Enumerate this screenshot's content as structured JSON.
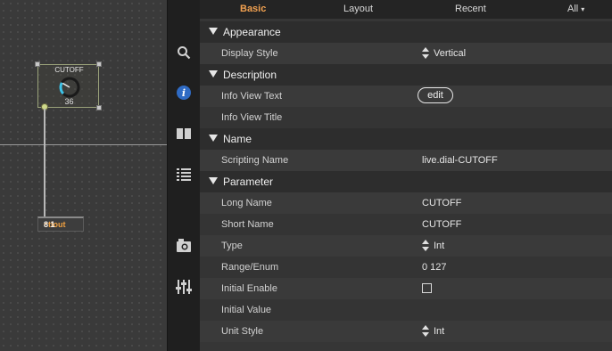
{
  "patcher": {
    "dial": {
      "label": "CUTOFF",
      "value": "36",
      "level_fraction": 0.28,
      "arc_color": "#3ec3e8"
    },
    "ctlout": {
      "keyword": "ctlout",
      "args": " 8 1"
    }
  },
  "sidebar": {
    "icons": [
      "search-icon",
      "info-icon",
      "book-icon",
      "list-icon",
      "snapshot-icon",
      "mixer-icon"
    ]
  },
  "tabs": [
    {
      "label": "Basic",
      "active": true
    },
    {
      "label": "Layout"
    },
    {
      "label": "Recent"
    },
    {
      "label": "All"
    }
  ],
  "inspector": {
    "sections": {
      "appearance": "Appearance",
      "description": "Description",
      "name": "Name",
      "parameter": "Parameter"
    },
    "rows": {
      "display_style": {
        "label": "Display Style",
        "value": "Vertical"
      },
      "info_view_text": {
        "label": "Info View Text",
        "button": "edit"
      },
      "info_view_title": {
        "label": "Info View Title",
        "value": ""
      },
      "scripting_name": {
        "label": "Scripting Name",
        "value": "live.dial-CUTOFF"
      },
      "long_name": {
        "label": "Long Name",
        "value": "CUTOFF"
      },
      "short_name": {
        "label": "Short Name",
        "value": "CUTOFF"
      },
      "type": {
        "label": "Type",
        "value": "Int"
      },
      "range_enum": {
        "label": "Range/Enum",
        "value": "0 127"
      },
      "initial_enable": {
        "label": "Initial Enable",
        "checked": false
      },
      "initial_value": {
        "label": "Initial Value",
        "value": ""
      },
      "unit_style": {
        "label": "Unit Style",
        "value": "Int"
      }
    }
  },
  "colors": {
    "accent_tab": "#f0a050",
    "info_icon_bg": "#2f6bc4"
  }
}
